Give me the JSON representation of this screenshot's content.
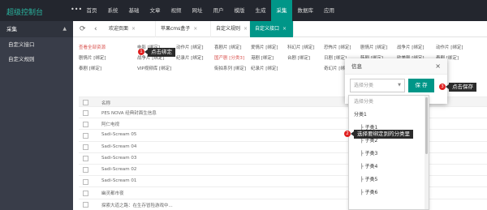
{
  "header": {
    "brand": "超级控制台",
    "menu_icon": "ellipsis-icon",
    "menu_glyph": "•••",
    "nav": [
      "首页",
      "系统",
      "基础",
      "文章",
      "视频",
      "网址",
      "用户",
      "模版",
      "生成",
      "采集",
      "数据库",
      "应用"
    ],
    "active_nav": "采集"
  },
  "sidebar": {
    "section": "采集",
    "items": [
      "自定义接口",
      "自定义规则"
    ]
  },
  "tabs": {
    "items": [
      "欢迎页面",
      "苹果cms盒子",
      "自定义规则",
      "自定义接口"
    ],
    "active": "自定义接口",
    "close_glyph": "×"
  },
  "filter": {
    "rows": [
      [
        "查看全部资源",
        "电影 [绑定]",
        "动作片 [绑定]",
        "喜剧片 [绑定]",
        "爱情片 [绑定]",
        "科幻片 [绑定]",
        "恐怖片 [绑定]",
        "剧情片 [绑定]",
        "战争片 [绑定]",
        "动作片 [绑定]"
      ],
      [
        "剧情片 [绑定]",
        "战争片 [绑定]",
        "纪录片 [绑定]",
        "国产剧 [分类3]",
        "港剧 [绑定]",
        "台剧 [绑定]",
        "日剧 [绑定]",
        "韩剧 [绑定]",
        "欧美剧 [绑定]",
        "泰剧 [绑定]"
      ],
      [
        "泰剧 [绑定]",
        "VIP视频库 [绑定]",
        "街拍系列 [绑定]",
        "纪录片 [绑定]",
        "奇幻片 [绑定]"
      ]
    ]
  },
  "table": {
    "header": "名称",
    "rows": [
      "PES NOVA 经典封面生信息",
      "阿仁电视",
      "Sadi-Scream 05",
      "Sadi-Scream 04",
      "Sadi-Scream 03",
      "Sadi-Scream 02",
      "Sadi-Scream 01",
      "幽灵都市夜",
      "探索大道之路：在生存冒险游戏中..."
    ]
  },
  "dialog": {
    "title": "信息",
    "close_glyph": "×",
    "select_placeholder": "选择分类",
    "save_label": "保 存"
  },
  "dropdown": {
    "options": [
      "选择分类",
      "分类1",
      "├ 子类1",
      "├ 子类2",
      "├ 子类3",
      "├ 子类4",
      "├ 子类5",
      "├ 子类6"
    ]
  },
  "annotations": [
    {
      "number": "1",
      "text": "点击绑定"
    },
    {
      "number": "2",
      "text": "选择要绑定到的分类里"
    },
    {
      "number": "3",
      "text": "点击保存"
    }
  ],
  "colors": {
    "header_bg": "#23262e",
    "sidebar_bg": "#393d49",
    "accent": "#009688",
    "brand": "#2ab5a0",
    "annotation_red": "#e02020"
  }
}
